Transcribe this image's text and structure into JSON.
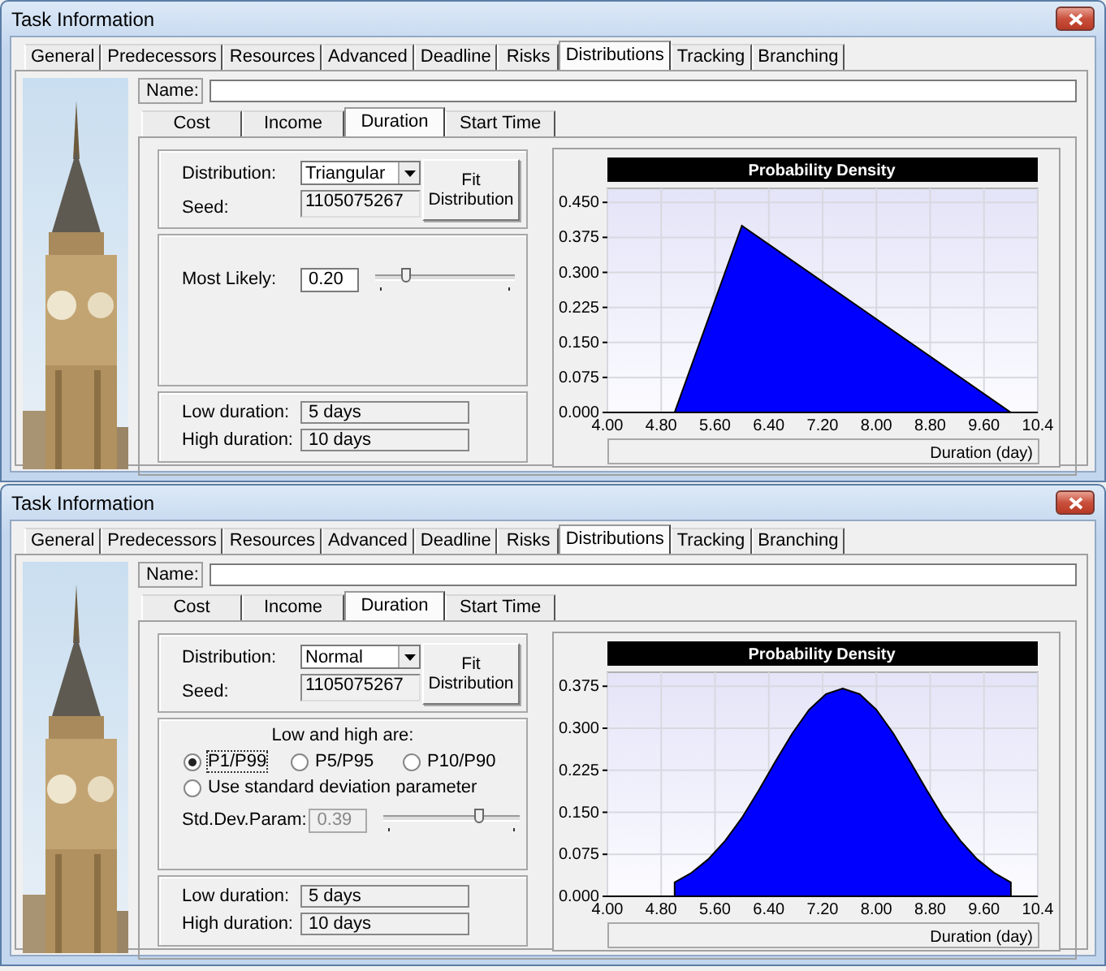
{
  "dialogs": [
    {
      "title": "Task Information",
      "tabs": [
        {
          "label": "General",
          "selected": false
        },
        {
          "label": "Predecessors",
          "selected": false
        },
        {
          "label": "Resources",
          "selected": false
        },
        {
          "label": "Advanced",
          "selected": false
        },
        {
          "label": "Deadline",
          "selected": false
        },
        {
          "label": "Risks",
          "selected": false
        },
        {
          "label": "Distributions",
          "selected": true
        },
        {
          "label": "Tracking",
          "selected": false
        },
        {
          "label": "Branching",
          "selected": false
        }
      ],
      "name_label": "Name:",
      "subtabs": [
        {
          "label": "Cost",
          "selected": false
        },
        {
          "label": "Income",
          "selected": false
        },
        {
          "label": "Duration",
          "selected": true
        },
        {
          "label": "Start Time",
          "selected": false
        }
      ],
      "distribution": {
        "label": "Distribution:",
        "value": "Triangular",
        "seed_label": "Seed:",
        "seed": "1105075267",
        "fit_button": "Fit Distribution"
      },
      "parameters": {
        "kind": "most_likely",
        "label": "Most Likely:",
        "value": "0.20",
        "level": 0.2
      },
      "durations": [
        {
          "label": "Low duration:",
          "value": "5 days"
        },
        {
          "label": "High duration:",
          "value": "10 days"
        }
      ],
      "chart_data": {
        "type": "area",
        "title": "Probability Density",
        "xlabel": "Duration (day)",
        "x": [
          5,
          6,
          10
        ],
        "series": [
          {
            "color": "#0000ff",
            "values": [
              0,
              0.4,
              0
            ]
          }
        ],
        "xlim": [
          4,
          10.4
        ],
        "ylim": [
          0,
          0.48
        ],
        "grid": true,
        "xticks": [
          {
            "value": 4,
            "label": "4.00"
          },
          {
            "value": 4.8,
            "label": "4.80"
          },
          {
            "value": 5.6,
            "label": "5.60"
          },
          {
            "value": 6.4,
            "label": "6.40"
          },
          {
            "value": 7.2,
            "label": "7.20"
          },
          {
            "value": 8,
            "label": "8.00"
          },
          {
            "value": 8.8,
            "label": "8.80"
          },
          {
            "value": 9.6,
            "label": "9.60"
          },
          {
            "value": 10.4,
            "label": "10.4"
          }
        ],
        "yticks": [
          {
            "value": 0,
            "label": "0.000"
          },
          {
            "value": 0.075,
            "label": "0.075"
          },
          {
            "value": 0.15,
            "label": "0.150"
          },
          {
            "value": 0.225,
            "label": "0.225"
          },
          {
            "value": 0.3,
            "label": "0.300"
          },
          {
            "value": 0.375,
            "label": "0.375"
          },
          {
            "value": 0.45,
            "label": "0.450"
          }
        ]
      }
    },
    {
      "title": "Task Information",
      "tabs": [
        {
          "label": "General",
          "selected": false
        },
        {
          "label": "Predecessors",
          "selected": false
        },
        {
          "label": "Resources",
          "selected": false
        },
        {
          "label": "Advanced",
          "selected": false
        },
        {
          "label": "Deadline",
          "selected": false
        },
        {
          "label": "Risks",
          "selected": false
        },
        {
          "label": "Distributions",
          "selected": true
        },
        {
          "label": "Tracking",
          "selected": false
        },
        {
          "label": "Branching",
          "selected": false
        }
      ],
      "name_label": "Name:",
      "subtabs": [
        {
          "label": "Cost",
          "selected": false
        },
        {
          "label": "Income",
          "selected": false
        },
        {
          "label": "Duration",
          "selected": true
        },
        {
          "label": "Start Time",
          "selected": false
        }
      ],
      "distribution": {
        "label": "Distribution:",
        "value": "Normal",
        "seed_label": "Seed:",
        "seed": "1105075267",
        "fit_button": "Fit Distribution"
      },
      "parameters": {
        "kind": "percentile",
        "heading": "Low and high are:",
        "options": [
          {
            "label": "P1/P99",
            "selected": true
          },
          {
            "label": "P5/P95",
            "selected": false
          },
          {
            "label": "P10/P90",
            "selected": false
          },
          {
            "label": "Use standard deviation parameter",
            "selected": false
          }
        ],
        "std_label": "Std.Dev.Param:",
        "std_value": "0.39",
        "std_disabled": true,
        "level": 0.72
      },
      "durations": [
        {
          "label": "Low duration:",
          "value": "5 days"
        },
        {
          "label": "High duration:",
          "value": "10 days"
        }
      ],
      "chart_data": {
        "type": "area",
        "title": "Probability Density",
        "xlabel": "Duration (day)",
        "x": [
          5,
          5.25,
          5.5,
          5.75,
          6,
          6.25,
          6.5,
          6.75,
          7,
          7.25,
          7.5,
          7.75,
          8,
          8.25,
          8.5,
          8.75,
          9,
          9.25,
          9.5,
          9.75,
          10
        ],
        "series": [
          {
            "color": "#0000ff",
            "values": [
              0.025,
              0.042,
              0.066,
              0.099,
              0.14,
              0.189,
              0.241,
              0.291,
              0.333,
              0.361,
              0.371,
              0.361,
              0.333,
              0.291,
              0.241,
              0.189,
              0.14,
              0.099,
              0.066,
              0.042,
              0.025
            ]
          }
        ],
        "xlim": [
          4,
          10.4
        ],
        "ylim": [
          0,
          0.4
        ],
        "grid": true,
        "xticks": [
          {
            "value": 4,
            "label": "4.00"
          },
          {
            "value": 4.8,
            "label": "4.80"
          },
          {
            "value": 5.6,
            "label": "5.60"
          },
          {
            "value": 6.4,
            "label": "6.40"
          },
          {
            "value": 7.2,
            "label": "7.20"
          },
          {
            "value": 8,
            "label": "8.00"
          },
          {
            "value": 8.8,
            "label": "8.80"
          },
          {
            "value": 9.6,
            "label": "9.60"
          },
          {
            "value": 10.4,
            "label": "10.4"
          }
        ],
        "yticks": [
          {
            "value": 0,
            "label": "0.000"
          },
          {
            "value": 0.075,
            "label": "0.075"
          },
          {
            "value": 0.15,
            "label": "0.150"
          },
          {
            "value": 0.225,
            "label": "0.225"
          },
          {
            "value": 0.3,
            "label": "0.300"
          },
          {
            "value": 0.375,
            "label": "0.375"
          }
        ]
      }
    }
  ]
}
